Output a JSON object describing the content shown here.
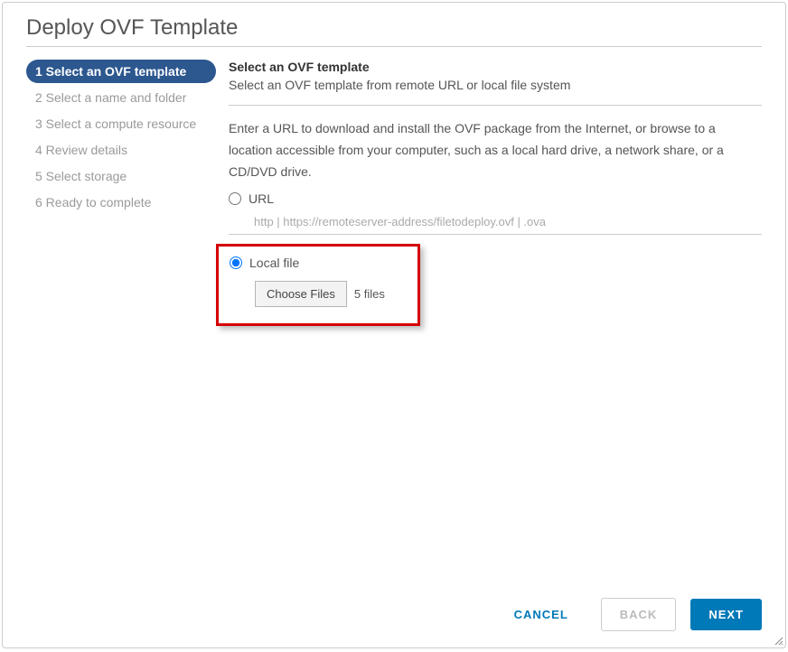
{
  "title": "Deploy OVF Template",
  "sidebar": {
    "steps": [
      {
        "label": "1 Select an OVF template",
        "active": true
      },
      {
        "label": "2 Select a name and folder",
        "active": false
      },
      {
        "label": "3 Select a compute resource",
        "active": false
      },
      {
        "label": "4 Review details",
        "active": false
      },
      {
        "label": "5 Select storage",
        "active": false
      },
      {
        "label": "6 Ready to complete",
        "active": false
      }
    ]
  },
  "main": {
    "heading": "Select an OVF template",
    "subheading": "Select an OVF template from remote URL or local file system",
    "instruction": "Enter a URL to download and install the OVF package from the Internet, or browse to a location accessible from your computer, such as a local hard drive, a network share, or a CD/DVD drive.",
    "url_option_label": "URL",
    "url_placeholder": "http | https://remoteserver-address/filetodeploy.ovf | .ova",
    "local_option_label": "Local file",
    "choose_files_label": "Choose Files",
    "file_count_text": "5 files",
    "source_selected": "local"
  },
  "footer": {
    "cancel_label": "CANCEL",
    "back_label": "BACK",
    "next_label": "NEXT"
  }
}
